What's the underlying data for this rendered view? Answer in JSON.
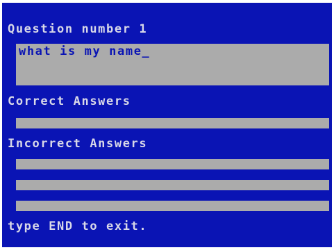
{
  "screen": {
    "question_heading": "Question number 1",
    "question_value": "what is my name_",
    "correct_heading": "Correct Answers",
    "correct_answers": [
      ""
    ],
    "incorrect_heading": "Incorrect Answers",
    "incorrect_answers": [
      "",
      "",
      ""
    ],
    "footer": "type END to exit."
  },
  "colors": {
    "background": "#0a14b4",
    "field": "#ababab",
    "text": "#d8d8e8"
  }
}
